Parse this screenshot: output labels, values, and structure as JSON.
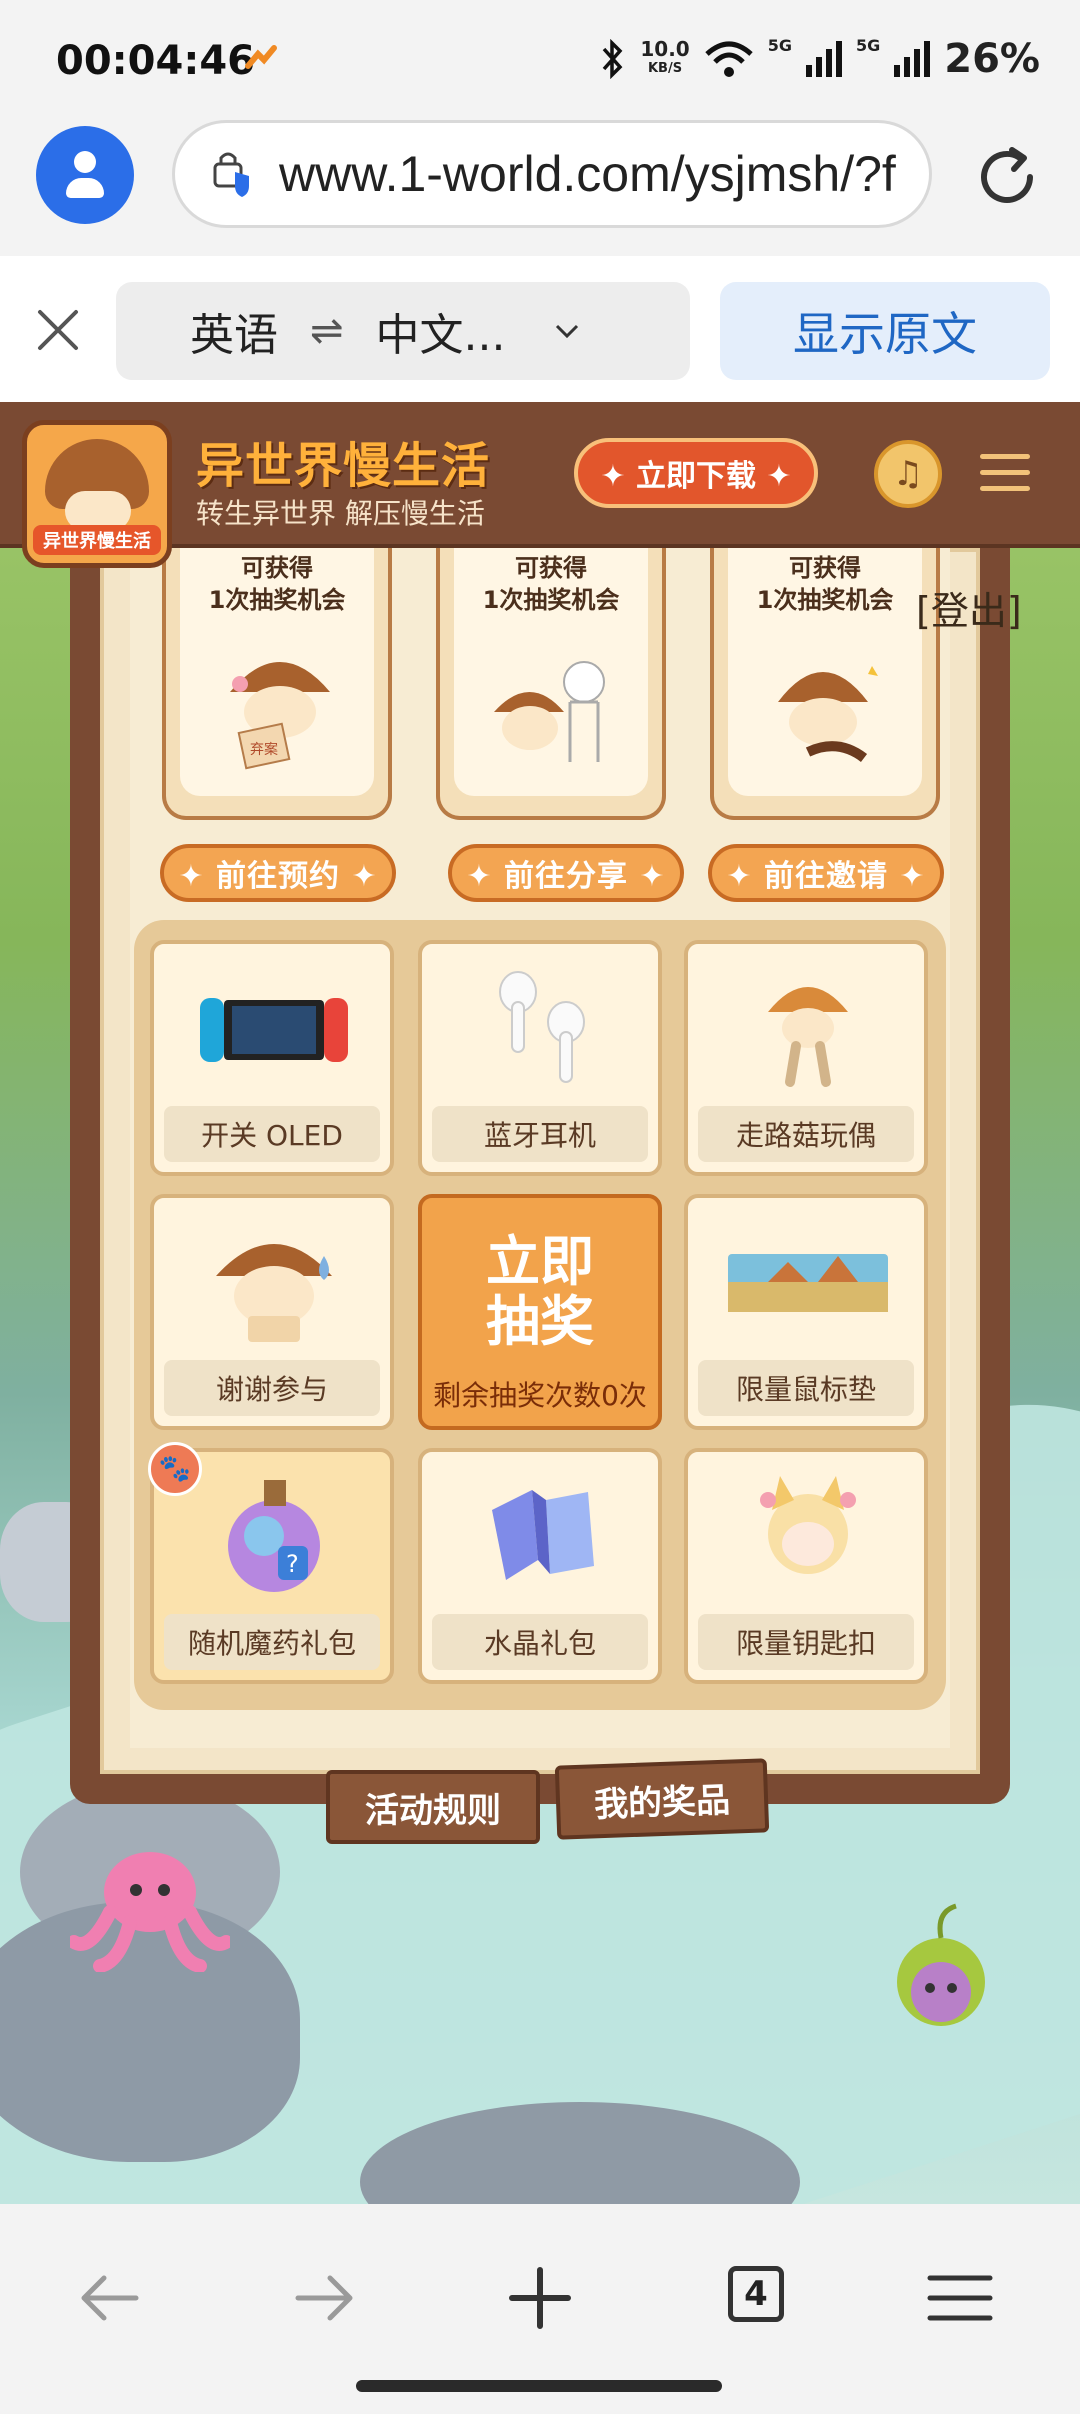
{
  "status_bar": {
    "time": "00:04:46",
    "net_speed_value": "10.0",
    "net_speed_unit": "KB/S",
    "sig1_label": "5G",
    "sig2_label": "5G",
    "battery": "26%"
  },
  "browser": {
    "url": "www.1-world.com/ysjmsh/?f"
  },
  "translate_bar": {
    "source_lang": "英语",
    "swap_symbol": "⇌",
    "target_lang": "中文...",
    "show_original": "显示原文"
  },
  "site_header": {
    "logo_text": "异世界慢生活",
    "title": "异世界慢生活",
    "subtitle": "转生异世界 解压慢生活",
    "download_label": "✦ 立即下载 ✦"
  },
  "page": {
    "logout": "[登出]",
    "reward_cards": [
      {
        "line1": "可获得",
        "line2": "1次抽奖机会",
        "sticker": "弃案"
      },
      {
        "line1": "可获得",
        "line2": "1次抽奖机会"
      },
      {
        "line1": "可获得",
        "line2": "1次抽奖机会"
      }
    ],
    "cta_buttons": [
      "✦ 前往预约 ✦",
      "✦ 前往分享 ✦",
      "✦ 前往邀请 ✦"
    ],
    "prizes": [
      {
        "label": "开关 OLED",
        "icon": "switch-console-icon"
      },
      {
        "label": "蓝牙耳机",
        "icon": "earbuds-icon"
      },
      {
        "label": "走路菇玩偶",
        "icon": "mushroom-doll-icon"
      },
      {
        "label": "谢谢参与",
        "icon": "crying-mushroom-icon"
      },
      {
        "label": "限量鼠标垫",
        "icon": "mousepad-icon"
      },
      {
        "label": "随机魔药礼包",
        "icon": "potion-icon"
      },
      {
        "label": "水晶礼包",
        "icon": "crystal-icon"
      },
      {
        "label": "限量钥匙扣",
        "icon": "keychain-icon"
      }
    ],
    "draw": {
      "line1": "立即",
      "line2": "抽奖",
      "remaining": "剩余抽奖次数0次"
    },
    "tabs": {
      "rules": "活动规则",
      "my_prizes": "我的奖品"
    }
  },
  "bottom_nav": {
    "tab_count": "4"
  },
  "colors": {
    "accent_blue": "#2b6ee8",
    "header_brown": "#7a4a33",
    "draw_orange": "#f2a34b"
  }
}
